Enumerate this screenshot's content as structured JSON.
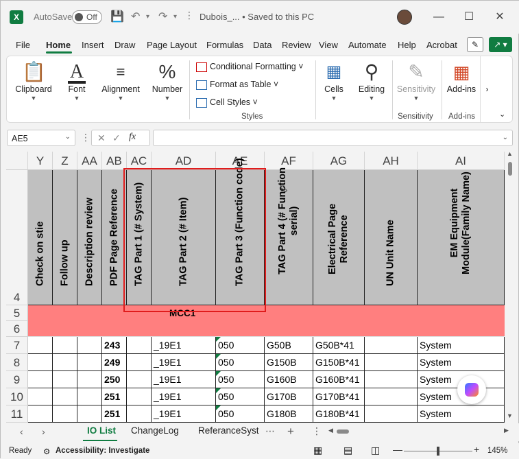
{
  "titlebar": {
    "app_icon": "excel-logo",
    "autosave_label": "AutoSave",
    "autosave_state": "Off",
    "doc_title": "Dubois_...  •  Saved to this PC",
    "controls": [
      "minimize-icon",
      "maximize-icon",
      "close-icon"
    ]
  },
  "menu": {
    "tabs": [
      "File",
      "Home",
      "Insert",
      "Draw",
      "Page Layout",
      "Formulas",
      "Data",
      "Review",
      "View",
      "Automate",
      "Help",
      "Acrobat"
    ],
    "active": "Home"
  },
  "ribbon": {
    "clipboard": "Clipboard",
    "font": "Font",
    "alignment": "Alignment",
    "number": "Number",
    "conditional_formatting": "Conditional Formatting",
    "format_as_table": "Format as Table",
    "cell_styles": "Cell Styles",
    "styles_group": "Styles",
    "cells": "Cells",
    "editing": "Editing",
    "sensitivity": "Sensitivity",
    "sensitivity_group": "Sensitivity",
    "addins": "Add-ins",
    "addins_group": "Add-ins"
  },
  "formula_bar": {
    "name_box": "AE5",
    "fx": "fx",
    "formula": ""
  },
  "columns": [
    "Y",
    "Z",
    "AA",
    "AB",
    "AC",
    "AD",
    "AE",
    "AF",
    "AG",
    "AH",
    "AI"
  ],
  "rows": [
    "4",
    "5",
    "6",
    "7",
    "8",
    "9",
    "10",
    "11"
  ],
  "header_row": [
    "Check on stie",
    "Follow up",
    "Description review",
    "PDF Page Reference",
    "TAG Part 1 (# System)",
    "TAG Part 2 (# Item)",
    "TAG Part 3 (Function code)",
    "TAG Part 4 (# Function serial)",
    "Electrical Page Reference",
    "UN Unit Name",
    "EM Equipment Module(Family Name)"
  ],
  "section_label": "MCC1",
  "data_rows": [
    {
      "ab": "243",
      "ad": "_19E1",
      "ae": "050",
      "af": "G50B",
      "ag": "G50B*41",
      "ai": "System"
    },
    {
      "ab": "249",
      "ad": "_19E1",
      "ae": "050",
      "af": "G150B",
      "ag": "G150B*41",
      "ai": "System"
    },
    {
      "ab": "250",
      "ad": "_19E1",
      "ae": "050",
      "af": "G160B",
      "ag": "G160B*41",
      "ai": "System"
    },
    {
      "ab": "251",
      "ad": "_19E1",
      "ae": "050",
      "af": "G170B",
      "ag": "G170B*41",
      "ai": "System"
    },
    {
      "ab": "251",
      "ad": "_19E1",
      "ae": "050",
      "af": "G180B",
      "ag": "G180B*41",
      "ai": "System"
    }
  ],
  "sheets": [
    "IO List",
    "ChangeLog",
    "ReferanceSyst"
  ],
  "active_sheet": "IO List",
  "status": {
    "ready": "Ready",
    "accessibility": "Accessibility: Investigate",
    "zoom": "145%"
  }
}
